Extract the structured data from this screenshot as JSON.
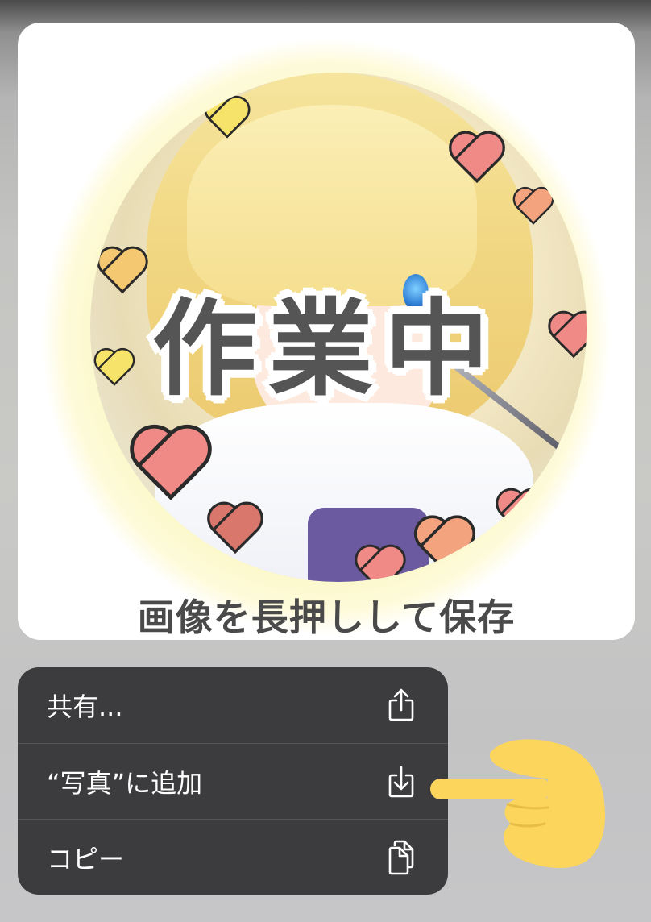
{
  "preview": {
    "overlay_text": "作業中",
    "caption": "画像を長押しして保存"
  },
  "context_menu": {
    "items": [
      {
        "label": "共有...",
        "icon": "share-icon"
      },
      {
        "label": "“写真”に追加",
        "icon": "save-to-photos-icon"
      },
      {
        "label": "コピー",
        "icon": "copy-icon"
      }
    ]
  },
  "colors": {
    "menu_background": "#3c3c3e",
    "menu_text": "#ffffff",
    "hand": "#fcd55c",
    "caption_text": "#4a4a4a"
  }
}
